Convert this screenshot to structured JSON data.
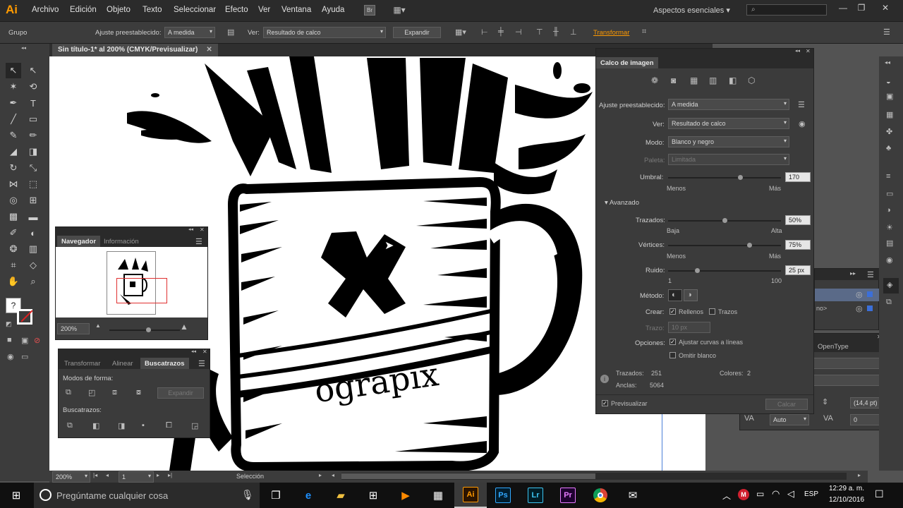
{
  "app": {
    "logo": "Ai",
    "menus": [
      "Archivo",
      "Edición",
      "Objeto",
      "Texto",
      "Seleccionar",
      "Efecto",
      "Ver",
      "Ventana",
      "Ayuda"
    ],
    "bridge_label": "Br",
    "workspace": "Aspectos esenciales",
    "search_placeholder": ""
  },
  "control": {
    "selection": "Grupo",
    "preset_label": "Ajuste preestablecido:",
    "preset_value": "A medida",
    "view_label": "Ver:",
    "view_value": "Resultado de calco",
    "expand": "Expandir",
    "transform": "Transformar"
  },
  "document": {
    "tab": "Sin título-1* al 200% (CMYK/Previsualizar)"
  },
  "artwork": {
    "banner_text": "ograpix"
  },
  "navigator": {
    "tabs": [
      "Navegador",
      "Información"
    ],
    "zoom": "200%"
  },
  "pathfinder": {
    "tabs": [
      "Transformar",
      "Alinear",
      "Buscatrazos"
    ],
    "shape_modes": "Modos de forma:",
    "expand": "Expandir",
    "pathfinders": "Buscatrazos:"
  },
  "trace": {
    "title": "Calco de imagen",
    "preset_label": "Ajuste preestablecido:",
    "preset_value": "A medida",
    "view_label": "Ver:",
    "view_value": "Resultado de calco",
    "mode_label": "Modo:",
    "mode_value": "Blanco y negro",
    "palette_label": "Paleta:",
    "palette_value": "Limitada",
    "threshold_label": "Umbral:",
    "threshold_value": "170",
    "threshold_level": 0.65,
    "threshold_min": "Menos",
    "threshold_max": "Más",
    "advanced": "Avanzado",
    "paths_label": "Trazados:",
    "paths_value": "50%",
    "paths_level": 0.5,
    "paths_min": "Baja",
    "paths_max": "Alta",
    "corners_label": "Vértices:",
    "corners_value": "75%",
    "corners_level": 0.73,
    "corners_min": "Menos",
    "corners_max": "Más",
    "noise_label": "Ruido:",
    "noise_value": "25 px",
    "noise_level": 0.25,
    "noise_min": "1",
    "noise_max": "100",
    "method_label": "Método:",
    "create_label": "Crear:",
    "fills": "Rellenos",
    "strokes": "Trazos",
    "stroke_label": "Trazo:",
    "stroke_value": "10 px",
    "options_label": "Opciones:",
    "snap": "Ajustar curvas a líneas",
    "ignore_white": "Omitir blanco",
    "paths_stat_label": "Trazados:",
    "paths_stat": "251",
    "colors_stat_label": "Colores:",
    "colors_stat": "2",
    "anchors_stat_label": "Anclas:",
    "anchors_stat": "5064",
    "preview": "Previsualizar",
    "trace_button": "Calcar"
  },
  "bg_panel": {
    "opentype_tab": "OpenType",
    "layer_text": "no>",
    "leading_value": "(14,4 pt)",
    "kerning_value": "Auto",
    "tracking_value": "0"
  },
  "status": {
    "zoom": "200%",
    "page": "1",
    "tool": "Selección"
  },
  "taskbar": {
    "search_placeholder": "Pregúntame cualquier cosa",
    "lang": "ESP",
    "time": "12:29 a. m.",
    "date": "12/10/2016",
    "apps": [
      "Ai",
      "Ps",
      "Lr",
      "Pr"
    ]
  },
  "colors": {
    "accent": "#ff9a00",
    "ps": "#31a8ff",
    "lr": "#3dc4f0",
    "pr": "#e77bff"
  }
}
